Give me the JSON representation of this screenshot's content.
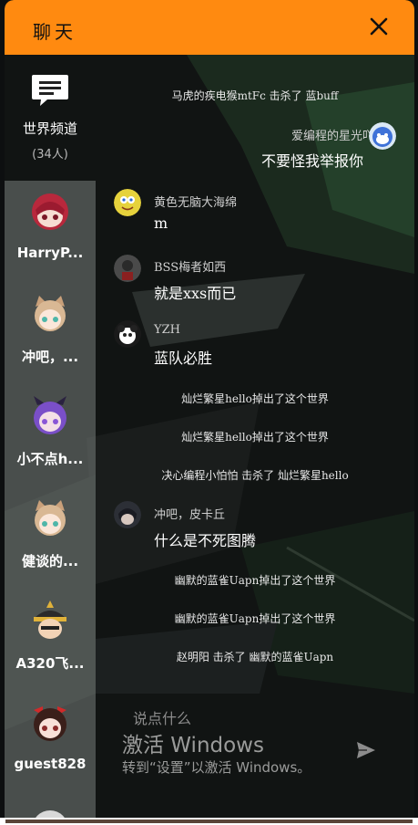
{
  "header": {
    "title": "聊天",
    "close_icon": "close-icon"
  },
  "channel": {
    "icon": "chat-bubble-icon",
    "name": "世界频道",
    "count": "(34人)"
  },
  "sidebar": {
    "users": [
      {
        "name": "HarryP...",
        "avatar": "avatar-red-hair"
      },
      {
        "name": "冲吧，...",
        "avatar": "avatar-cat-ears"
      },
      {
        "name": "小不点h...",
        "avatar": "avatar-purple-hair"
      },
      {
        "name": "健谈的...",
        "avatar": "avatar-cat-ears"
      },
      {
        "name": "A320飞...",
        "avatar": "avatar-samurai-helmet"
      },
      {
        "name": "guest828",
        "avatar": "avatar-red-bow"
      }
    ]
  },
  "messages": {
    "sys1": "马虎的疾电猴mtFc 击杀了 蓝buff",
    "self_msg": {
      "name": "爱编程的星光吖",
      "text": "不要怪我举报你",
      "avatar": "avatar-blue-mascot"
    },
    "msg1": {
      "name": "黄色无脑大海绵",
      "text": "m",
      "avatar": "avatar-spongebob"
    },
    "msg2": {
      "name": "BSS梅者如西",
      "text": "就是xxs而已",
      "avatar": "avatar-dark-figure"
    },
    "msg3": {
      "name": "YZH",
      "text": "蓝队必胜",
      "avatar": "avatar-panda"
    },
    "sys2": "灿烂繁星hello掉出了这个世界",
    "sys3": "灿烂繁星hello掉出了这个世界",
    "sys4": "决心编程小怕怕 击杀了 灿烂繁星hello",
    "msg4": {
      "name": "冲吧，皮卡丘",
      "text": "什么是不死图腾",
      "avatar": "avatar-dark-hero"
    },
    "sys5": "幽默的蓝雀Uapn掉出了这个世界",
    "sys6": "幽默的蓝雀Uapn掉出了这个世界",
    "sys7": "赵明阳 击杀了 幽默的蓝雀Uapn"
  },
  "input": {
    "placeholder": "说点什么",
    "send_icon": "send-icon"
  },
  "watermark": {
    "line1": "激活 Windows",
    "line2": "转到“设置”以激活 Windows。"
  },
  "colors": {
    "header": "#ff8a10",
    "sidebar": "#787e7c",
    "background": "#101412"
  }
}
